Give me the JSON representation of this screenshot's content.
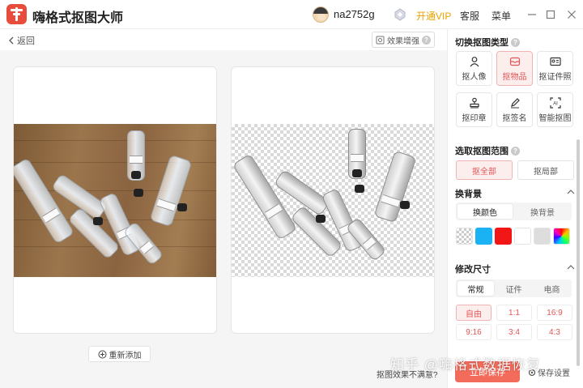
{
  "app": {
    "title": "嗨格式抠图大师",
    "username": "na2752g",
    "vip_label": "开通VIP",
    "service_label": "客服",
    "menu_label": "菜单",
    "accent_color": "#e25555",
    "vip_color": "#e9a200"
  },
  "toolbar": {
    "back_label": "返回",
    "enhance_label": "效果增强"
  },
  "canvas": {
    "add_again_label": "重新添加",
    "unsatisfied_label": "抠图效果不满意?",
    "watermark_text": "知乎 @嗨格式数据恢复"
  },
  "sidebar": {
    "cutout_type": {
      "title": "切换抠图类型",
      "items": [
        {
          "label": "抠人像",
          "icon": "person-icon",
          "active": false
        },
        {
          "label": "抠物品",
          "icon": "box-icon",
          "active": true
        },
        {
          "label": "抠证件照",
          "icon": "id-card-icon",
          "active": false
        },
        {
          "label": "抠印章",
          "icon": "stamp-icon",
          "active": false
        },
        {
          "label": "抠签名",
          "icon": "pen-icon",
          "active": false
        },
        {
          "label": "智能抠图",
          "icon": "ai-icon",
          "active": false
        }
      ]
    },
    "range": {
      "title": "选取抠图范围",
      "items": [
        {
          "label": "抠全部",
          "active": true
        },
        {
          "label": "抠局部",
          "active": false
        }
      ]
    },
    "background": {
      "title": "换背景",
      "tabs": [
        {
          "label": "换颜色",
          "active": true
        },
        {
          "label": "换背景",
          "active": false
        }
      ],
      "swatches": [
        "transparent",
        "#1ab2f2",
        "#f21616",
        "#ffffff",
        "#dddddd",
        "rainbow"
      ]
    },
    "resize": {
      "title": "修改尺寸",
      "tabs": [
        {
          "label": "常规",
          "active": true
        },
        {
          "label": "证件",
          "active": false
        },
        {
          "label": "电商",
          "active": false
        }
      ],
      "ratios": [
        {
          "label": "自由",
          "active": true
        },
        {
          "label": "1:1",
          "active": false
        },
        {
          "label": "16:9",
          "active": false
        },
        {
          "label": "9:16",
          "active": false
        },
        {
          "label": "3:4",
          "active": false
        },
        {
          "label": "4:3",
          "active": false
        }
      ]
    },
    "save_label": "立即保存",
    "save_settings_label": "保存设置"
  }
}
